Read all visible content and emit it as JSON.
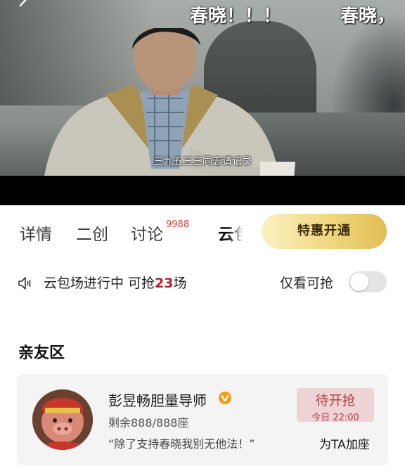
{
  "video": {
    "danmaku": [
      "春晓！！！",
      "春晓，"
    ],
    "subtitle": "三九五三三同志请记录"
  },
  "tabs": {
    "items": [
      "详情",
      "二创",
      "讨论",
      "云包场"
    ],
    "discussion_count": "9988",
    "promo_button": "特惠开通"
  },
  "status": {
    "prefix": "云包场进行中 可抢",
    "count": "23",
    "suffix": "场",
    "filter_label": "仅看可抢",
    "filter_enabled": false
  },
  "section": {
    "title": "亲友区"
  },
  "card": {
    "host_name": "彭昱畅胆量导师",
    "seats": "剩余888/888座",
    "quote": "“除了支持春晓我别无他法！”",
    "reserve_label": "待开抢",
    "reserve_time": "今日 22:00",
    "seat_link": "为TA加座"
  },
  "colors": {
    "accent_red": "#b51f2c",
    "promo_gold": "#f0d780",
    "reserve_bg": "#efd4d6",
    "verified_orange": "#f39b1a"
  }
}
